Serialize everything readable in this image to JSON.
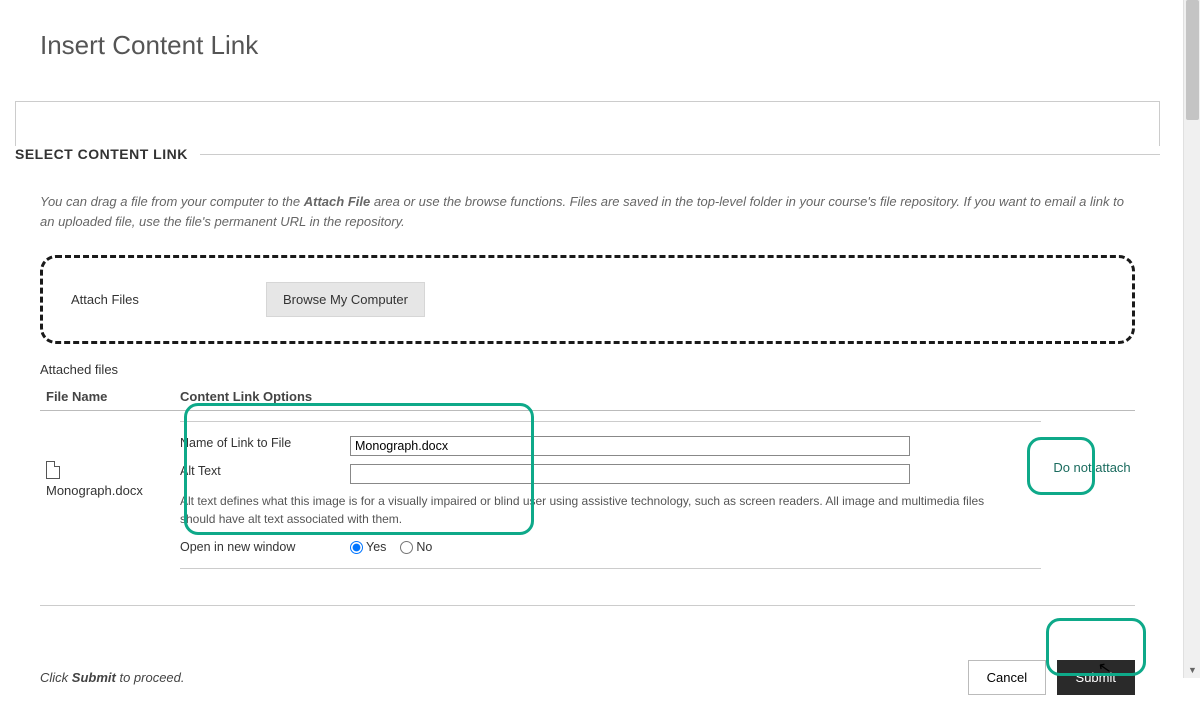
{
  "page": {
    "title": "Insert Content Link",
    "section_label": "SELECT CONTENT LINK",
    "help_prefix": "You can drag a file from your computer to the ",
    "help_bold": "Attach File",
    "help_suffix": " area or use the browse functions. Files are saved in the top-level folder in your course's file repository. If you want to email a link to an uploaded file, use the file's permanent URL in the repository."
  },
  "attach": {
    "label": "Attach Files",
    "browse_btn": "Browse My Computer"
  },
  "table": {
    "heading": "Attached files",
    "col_filename": "File Name",
    "col_options": "Content Link Options"
  },
  "file": {
    "name": "Monograph.docx",
    "do_not_attach": "Do not attach"
  },
  "options": {
    "name_label": "Name of Link to File",
    "name_value": "Monograph.docx",
    "alt_label": "Alt Text",
    "alt_value": "",
    "alt_desc": "Alt text defines what this image is for a visually impaired or blind user using assistive technology, such as screen readers. All image and multimedia files should have alt text associated with them.",
    "open_label": "Open in new window",
    "yes": "Yes",
    "no": "No",
    "selected": "yes"
  },
  "footer": {
    "prefix": "Click ",
    "bold": "Submit",
    "suffix": " to proceed.",
    "cancel": "Cancel",
    "submit": "Submit"
  }
}
